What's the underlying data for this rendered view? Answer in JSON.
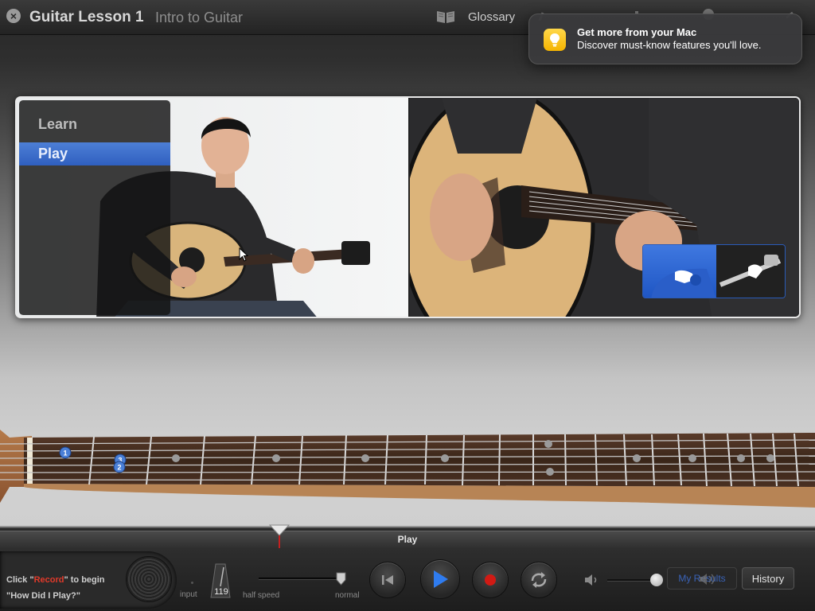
{
  "header": {
    "lesson_title": "Guitar Lesson 1",
    "lesson_subtitle": "Intro to Guitar",
    "glossary_label": "Glossary"
  },
  "notification": {
    "title": "Get more from your Mac",
    "body": "Discover must-know features you'll love."
  },
  "mode_menu": {
    "items": [
      {
        "label": "Learn",
        "selected": false
      },
      {
        "label": "Play",
        "selected": true
      }
    ]
  },
  "fretboard": {
    "finger_markers": [
      "1",
      "3",
      "2"
    ]
  },
  "transport": {
    "strip_label": "Play",
    "hint_prefix": "Click \"",
    "hint_record": "Record",
    "hint_suffix": "\" to begin",
    "hint_line2": "\"How Did I Play?\"",
    "input_label": "input",
    "tempo": "119",
    "half_speed_label": "half speed",
    "normal_label": "normal",
    "my_results_label": "My Results",
    "history_label": "History"
  },
  "colors": {
    "accent_blue": "#2f5fbf",
    "record_red": "#d11a14",
    "hint_red": "#e23a2a"
  }
}
